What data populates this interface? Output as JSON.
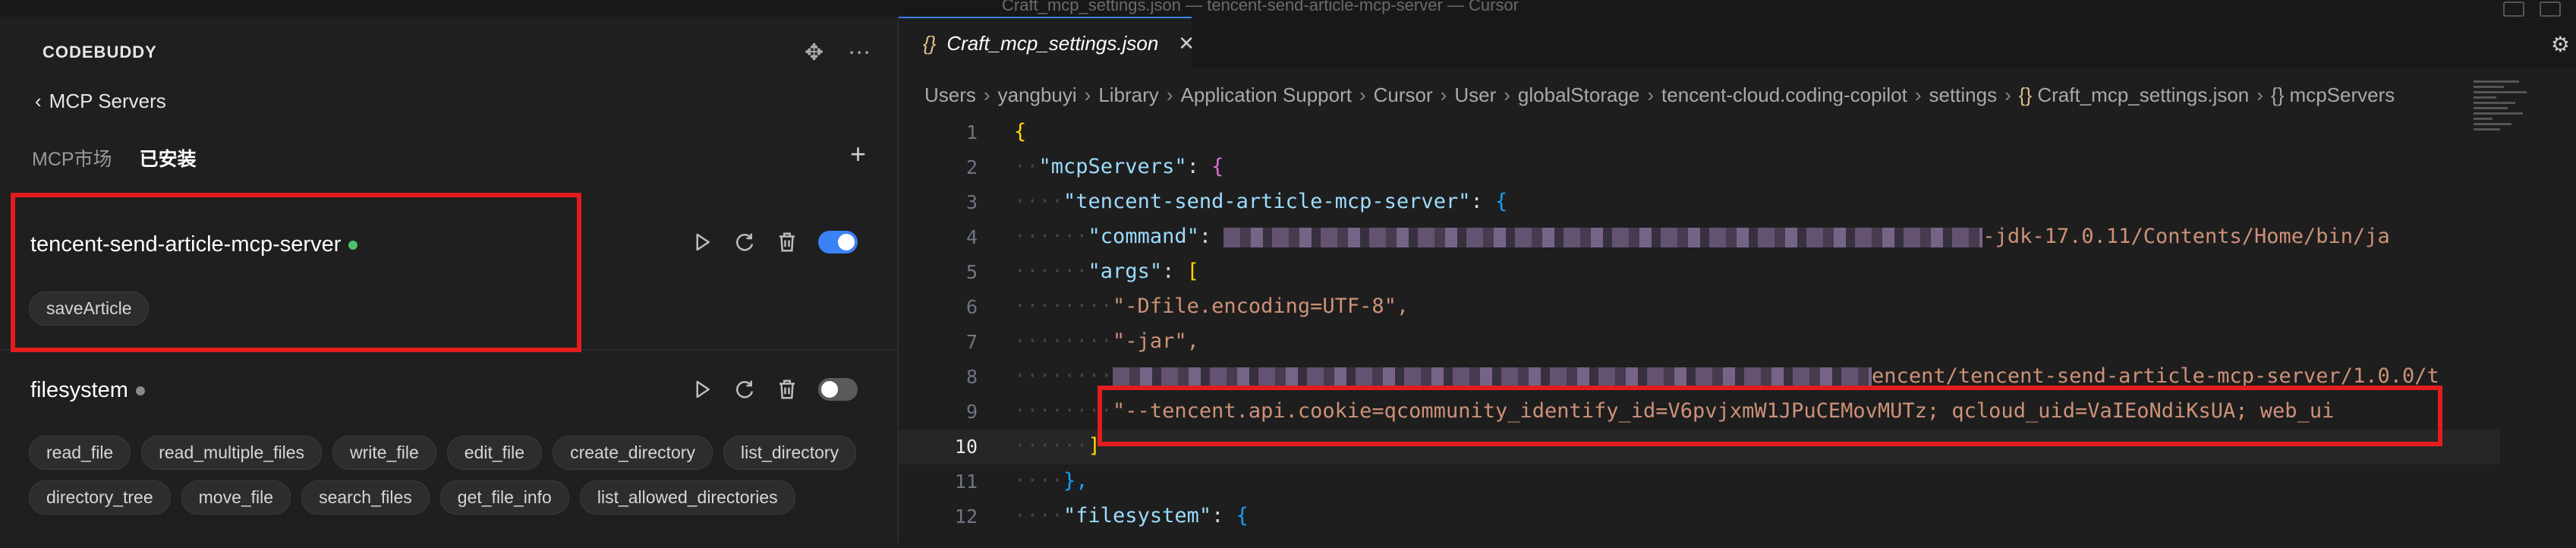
{
  "window": {
    "title": "Craft_mcp_settings.json — tencent-send-article-mcp-server — Cursor"
  },
  "panel": {
    "brand": "CODEBUDDY",
    "back_label": "MCP Servers",
    "tabs": [
      {
        "label": "MCP市场",
        "active": false
      },
      {
        "label": "已安装",
        "active": true
      }
    ]
  },
  "servers": [
    {
      "name": "tencent-send-article-mcp-server",
      "status_color": "#4ec267",
      "enabled": true,
      "tools": [
        "saveArticle"
      ]
    },
    {
      "name": "filesystem",
      "status_color": "#8a8a8a",
      "enabled": false,
      "tools": [
        "read_file",
        "read_multiple_files",
        "write_file",
        "edit_file",
        "create_directory",
        "list_directory",
        "directory_tree",
        "move_file",
        "search_files",
        "get_file_info",
        "list_allowed_directories"
      ]
    }
  ],
  "editor": {
    "tab_label": "Craft_mcp_settings.json",
    "tab_icon": "{}",
    "breadcrumb": [
      "Users",
      "yangbuyi",
      "Library",
      "Application Support",
      "Cursor",
      "User",
      "globalStorage",
      "tencent-cloud.coding-copilot",
      "settings"
    ],
    "breadcrumb_file": "Craft_mcp_settings.json",
    "breadcrumb_symbol": "mcpServers",
    "breadcrumb_symbol_icon": "{}",
    "current_line": 10,
    "lines": {
      "l1": "{",
      "l2_key": "\"mcpServers\"",
      "l3_key": "\"tencent-send-article-mcp-server\"",
      "l4_key": "\"command\"",
      "l4_val_tail": "-jdk-17.0.11/Contents/Home/bin/ja",
      "l5_key": "\"args\"",
      "l6": "\"-Dfile.encoding=UTF-8\",",
      "l7": "\"-jar\",",
      "l8_tail": "encent/tencent-send-article-mcp-server/1.0.0/t",
      "l9": "\"--tencent.api.cookie=qcommunity_identify_id=V6pvjxmW1JPuCEMovMUTz; qcloud_uid=VaIEoNdiKsUA; web_ui",
      "l11": "},",
      "l12_key": "\"filesystem\""
    }
  },
  "colors": {
    "accent": "#3b82f6",
    "highlight_box": "#e21d1d"
  }
}
